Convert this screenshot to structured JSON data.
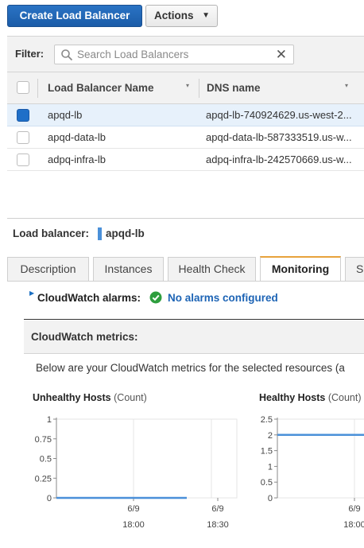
{
  "toolbar": {
    "create_label": "Create Load Balancer",
    "actions_label": "Actions",
    "actions_caret": "▼"
  },
  "filter": {
    "label": "Filter:",
    "placeholder": "Search Load Balancers",
    "clear_glyph": "✕"
  },
  "table": {
    "columns": [
      "Load Balancer Name",
      "DNS name"
    ],
    "sort_caret": "▾",
    "rows": [
      {
        "name": "apqd-lb",
        "dns": "apqd-lb-740924629.us-west-2...",
        "selected": true
      },
      {
        "name": "apqd-data-lb",
        "dns": "apqd-data-lb-587333519.us-w...",
        "selected": false
      },
      {
        "name": "adpq-infra-lb",
        "dns": "adpq-infra-lb-242570669.us-w...",
        "selected": false
      }
    ]
  },
  "detail": {
    "title": "Load balancer:",
    "selected_name": "apqd-lb",
    "tabs": [
      {
        "label": "Description",
        "active": false
      },
      {
        "label": "Instances",
        "active": false
      },
      {
        "label": "Health Check",
        "active": false
      },
      {
        "label": "Monitoring",
        "active": true
      },
      {
        "label": "S",
        "active": false
      }
    ],
    "alarms_label": "CloudWatch alarms:",
    "alarms_status": "No alarms configured",
    "metrics_label": "CloudWatch metrics:",
    "metrics_description": "Below are your CloudWatch metrics for the selected resources (a"
  },
  "colors": {
    "primary_button": "#1f65b6",
    "selected_row": "#e7f1fb",
    "active_tab_accent": "#e8a23c",
    "link": "#1d64b5",
    "ok_green": "#2e9e3e",
    "series_line": "#4a90d9"
  },
  "chart_data": [
    {
      "type": "line",
      "title": "Unhealthy Hosts",
      "unit": "(Count)",
      "y_ticks": [
        "1",
        "0.75",
        "0.5",
        "0.25",
        "0"
      ],
      "ylim": [
        0,
        1
      ],
      "x_ticks": [
        {
          "date": "6/9",
          "time": "18:00"
        },
        {
          "date": "6/9",
          "time": "18:30"
        }
      ],
      "series": [
        {
          "values": [
            0,
            0
          ]
        }
      ],
      "grid": true
    },
    {
      "type": "line",
      "title": "Healthy Hosts",
      "unit": "(Count)",
      "y_ticks": [
        "2.5",
        "2",
        "1.5",
        "1",
        "0.5",
        "0"
      ],
      "ylim": [
        0,
        2.5
      ],
      "x_ticks": [
        {
          "date": "6/9",
          "time": "18:00"
        }
      ],
      "series": [
        {
          "values": [
            2,
            2
          ]
        }
      ],
      "grid": true
    }
  ]
}
